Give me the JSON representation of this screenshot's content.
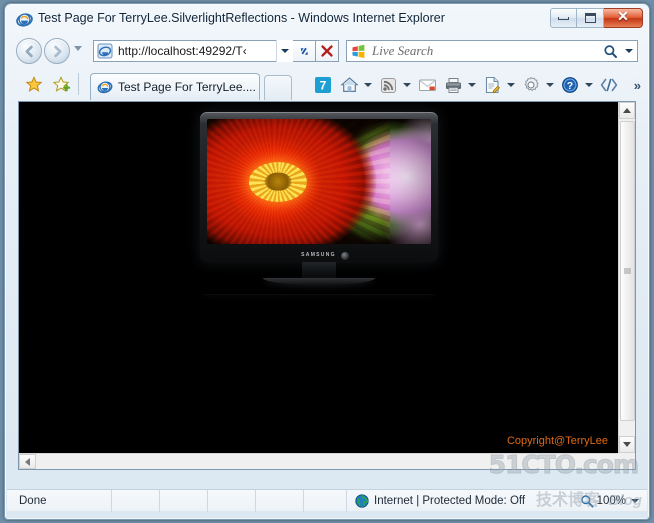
{
  "window": {
    "title": "Test Page For TerryLee.SilverlightReflections - Windows Internet Explorer",
    "app_icon": "ie-logo-icon",
    "minimize_label": "Minimize",
    "maximize_label": "Maximize",
    "close_label": "Close",
    "close_glyph": "✕"
  },
  "navbar": {
    "back_label": "Back",
    "back_glyph": "←",
    "forward_label": "Forward",
    "forward_glyph": "→",
    "recent_pages_label": "Recent Pages",
    "address": {
      "value": "http://localhost:49292/T‹",
      "full_url": "http://localhost:49292/T",
      "favicon": "ie-page-icon",
      "dropdown_label": "Address dropdown"
    },
    "refresh_label": "Refresh",
    "refresh_glyph": "↻",
    "stop_label": "Stop",
    "stop_glyph": "✕",
    "search": {
      "value": "",
      "placeholder": "Live Search",
      "provider_icon": "windows-logo-icon",
      "go_label": "Search",
      "go_glyph": "⌕",
      "options_label": "Search options"
    }
  },
  "tabbar": {
    "favorites_center_label": "Favorites Center",
    "add_favorites_label": "Add to Favorites",
    "tabs": [
      {
        "label": "Test Page For TerryLee....",
        "icon": "ie-page-icon",
        "active": true
      }
    ],
    "new_tab_label": "New Tab",
    "command_buttons": [
      {
        "name": "ie7-badge",
        "label": "7",
        "caret": false
      },
      {
        "name": "home-button",
        "label": "Home",
        "caret": true
      },
      {
        "name": "feeds-button",
        "label": "Feeds",
        "caret": true
      },
      {
        "name": "mail-button",
        "label": "Read Mail",
        "caret": false
      },
      {
        "name": "print-button",
        "label": "Print",
        "caret": true
      },
      {
        "name": "page-button",
        "label": "Page",
        "caret": true
      },
      {
        "name": "tools-button",
        "label": "Tools",
        "caret": true
      },
      {
        "name": "help-button",
        "label": "Help",
        "caret": true
      },
      {
        "name": "blend-button",
        "label": "Expression",
        "caret": false
      }
    ],
    "overflow_label": "»"
  },
  "page": {
    "background_color": "#000000",
    "copyright": "Copyright@TerryLee",
    "copyright_color": "#e06a14",
    "device": {
      "brand": "SAMSUNG",
      "description": "Samsung flat-panel television displaying a red dahlia flower photograph",
      "reflection": true
    },
    "scrollbars": {
      "vertical_up_label": "Scroll up",
      "vertical_down_label": "Scroll down",
      "horizontal_left_label": "Scroll left"
    }
  },
  "statusbar": {
    "status_text": "Done",
    "zone_icon": "globe-icon",
    "zone_text": "Internet | Protected Mode: Off",
    "zoom_icon": "magnifier-icon",
    "zoom_level": "100%",
    "zoom_caret_label": "Change zoom level"
  },
  "watermark": {
    "site": "51CTO.com",
    "chinese": "技术博客",
    "blog": "Blog"
  }
}
